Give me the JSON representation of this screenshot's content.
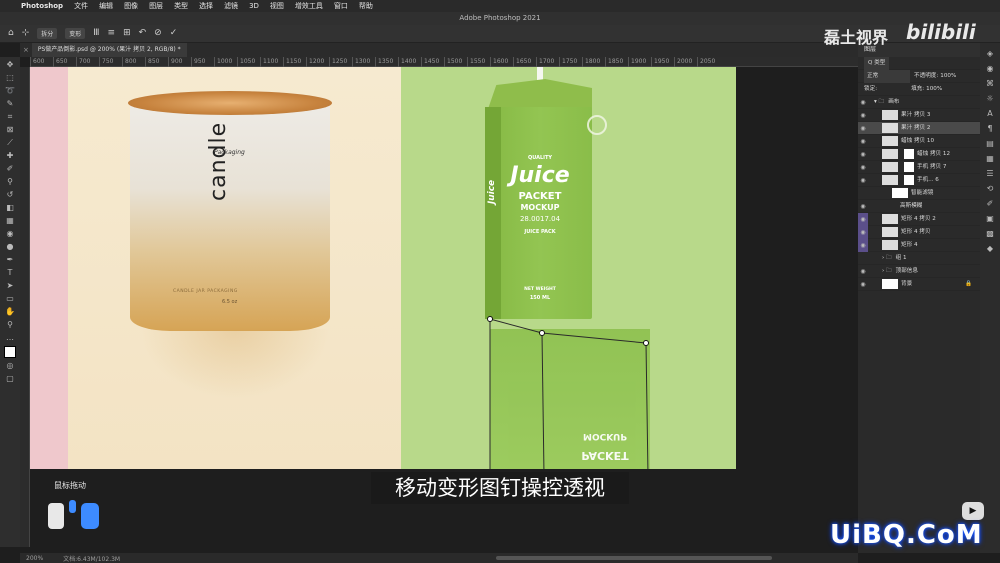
{
  "menubar": {
    "apple": "",
    "app": "Photoshop",
    "items": [
      "文件",
      "编辑",
      "图像",
      "图层",
      "类型",
      "选择",
      "滤镜",
      "3D",
      "视图",
      "增效工具",
      "窗口",
      "帮助"
    ]
  },
  "window": {
    "title": "Adobe Photoshop 2021"
  },
  "options": {
    "btn1": "拆分",
    "btn2": "变形"
  },
  "doc_tab": {
    "label": "PS做产品倒影.psd @ 200% (果汁 拷贝 2, RGB/8) *"
  },
  "ruler": {
    "ticks": [
      "600",
      "650",
      "700",
      "750",
      "800",
      "850",
      "900",
      "950",
      "1000",
      "1050",
      "1100",
      "1150",
      "1200",
      "1250",
      "1300",
      "1350",
      "1400",
      "1450",
      "1500",
      "1550",
      "1600",
      "1650",
      "1700",
      "1750",
      "1800",
      "1850",
      "1900",
      "1950",
      "2000",
      "2050"
    ]
  },
  "candle": {
    "word": "candle",
    "brand": "Packaging",
    "sub": "CANDLE JAR PACKAGING",
    "oz": "6.5 oz"
  },
  "juice": {
    "quality": "QUALITY",
    "title": "Juice",
    "line1": "PACKET",
    "line2": "MOCKUP",
    "date": "28.0017.04",
    "pack": "JUICE PACK",
    "side_title": "Juice",
    "side1": "PACKET",
    "side2": "MOCKUP",
    "weight_label": "NET WEIGHT",
    "weight": "150 ML"
  },
  "subtitle": "移动变形图钉操控透视",
  "hint": {
    "label": "鼠标拖动"
  },
  "status": {
    "zoom": "200%",
    "doc": "文档:6.43M/102.3M"
  },
  "watermark": {
    "site": "磊土视界",
    "bili": "bilibili",
    "uibq": "UiBQ.CoM"
  },
  "layers": {
    "tab": "图层",
    "kind": "Q 类型",
    "blend": "正常",
    "opacity_label": "不透明度:",
    "opacity": "100%",
    "lock_label": "锁定:",
    "fill_label": "填充:",
    "fill": "100%",
    "rows": [
      {
        "name": "画布"
      },
      {
        "name": "果汁 拷贝 3"
      },
      {
        "name": "果汁 拷贝 2"
      },
      {
        "name": "蜡烛 拷贝 10"
      },
      {
        "name": "蜡烛 拷贝 12"
      },
      {
        "name": "手机 拷贝 7"
      },
      {
        "name": "手机... 6"
      },
      {
        "name": "智能滤镜"
      },
      {
        "name": "高斯模糊"
      },
      {
        "name": "矩形 4 拷贝 2"
      },
      {
        "name": "矩形 4 拷贝"
      },
      {
        "name": "矩形 4"
      },
      {
        "name": "组 1"
      },
      {
        "name": "顶部信息"
      },
      {
        "name": "背景"
      }
    ]
  }
}
